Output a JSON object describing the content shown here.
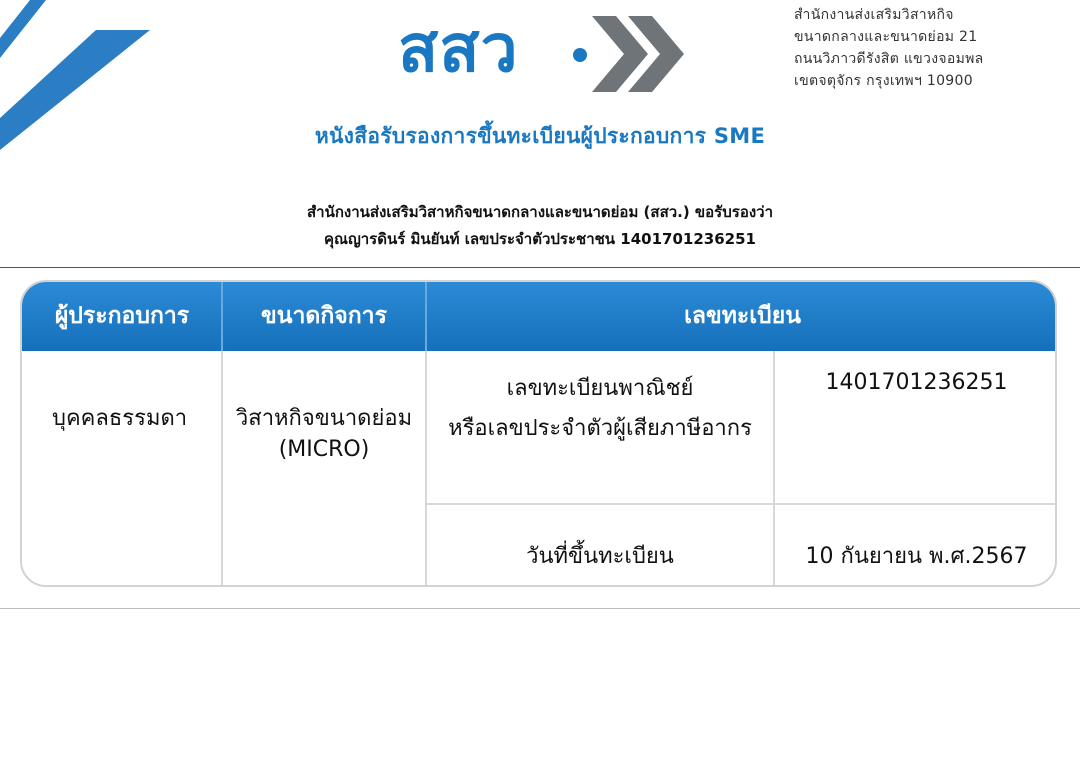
{
  "header": {
    "logo_text": "สสว",
    "address_lines": [
      "สำนักงานส่งเสริมวิสาหกิจ",
      "ขนาดกลางและขนาดย่อม 21",
      "ถนนวิภาวดีรังสิต แขวงจอมพล",
      "เขตจตุจักร กรุงเทพฯ 10900"
    ]
  },
  "certificate": {
    "title": "หนังสือรับรองการขึ้นทะเบียนผู้ประกอบการ SME",
    "line1": "สำนักงานส่งเสริมวิสาหกิจขนาดกลางและขนาดย่อม (สสว.) ขอรับรองว่า",
    "line2": "คุณญารดินร์  มินยันท์ เลขประจำตัวประชาชน 1401701236251"
  },
  "table": {
    "headers": [
      "ผู้ประกอบการ",
      "ขนาดกิจการ",
      "เลขทะเบียน"
    ],
    "entrepreneur_type": "บุคคลธรรมดา",
    "business_size": "วิสาหกิจขนาดย่อม",
    "business_size_en": "(MICRO)",
    "reg_label_line1": "เลขทะเบียนพาณิชย์",
    "reg_label_line2": "หรือเลขประจำตัวผู้เสียภาษีอากร",
    "reg_number": "1401701236251",
    "date_label": "วันที่ขึ้นทะเบียน",
    "date_value": "10 กันยายน พ.ศ.2567"
  },
  "colors": {
    "brand_blue": "#1a78c2",
    "header_blue": "#1f7fc9",
    "accent_gray": "#6f7478"
  }
}
